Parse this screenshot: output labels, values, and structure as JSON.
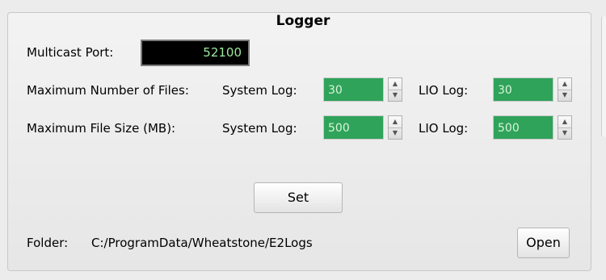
{
  "panel": {
    "title": "Logger"
  },
  "multicast": {
    "label": "Multicast Port:",
    "value": "52100"
  },
  "max_files": {
    "label": "Maximum Number of Files:",
    "system_label": "System Log:",
    "system_value": "30",
    "lio_label": "LIO Log:",
    "lio_value": "30"
  },
  "max_size": {
    "label": "Maximum File Size (MB):",
    "system_label": "System Log:",
    "system_value": "500",
    "lio_label": "LIO Log:",
    "lio_value": "500"
  },
  "set_button": "Set",
  "folder": {
    "label": "Folder:",
    "path": "C:/ProgramData/Wheatstone/E2Logs"
  },
  "open_button": "Open",
  "colors": {
    "spin_fill": "#2fa35a",
    "port_bg": "#000000",
    "port_text": "#9ee89e"
  }
}
